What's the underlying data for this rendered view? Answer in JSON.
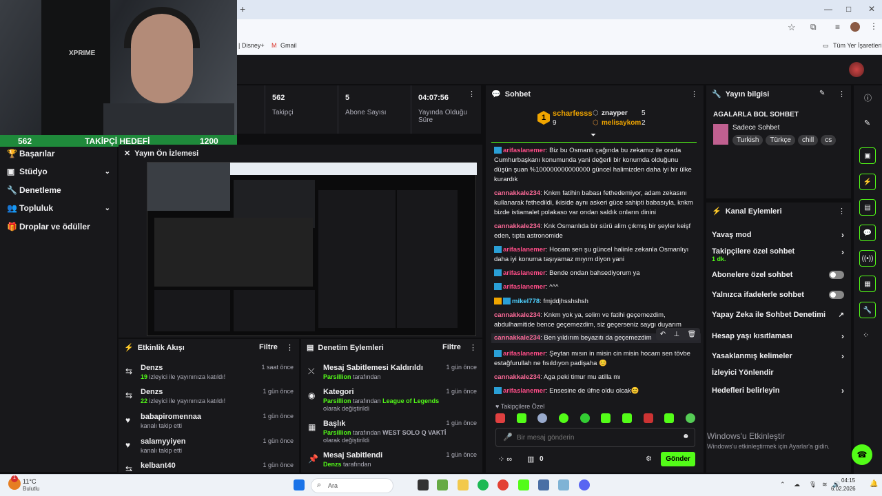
{
  "browser": {
    "new_tab": "+",
    "bookmarks": [
      "| Disney+",
      "Gmail"
    ],
    "bookmarks_folder": "Tüm Yer İşaretleri",
    "window_controls": [
      "—",
      "□",
      "✕"
    ]
  },
  "webcam": {
    "brand": "XPRIME"
  },
  "goal": {
    "current": "562",
    "label": "TAKİPÇİ HEDEFİ",
    "target": "1200"
  },
  "sidebar": {
    "items": [
      {
        "label": "Başarılar",
        "icon": "trophy-icon"
      },
      {
        "label": "Stüdyo",
        "icon": "video-icon",
        "chevron": "⌄"
      },
      {
        "label": "Denetleme",
        "icon": "wrench-icon"
      },
      {
        "label": "Topluluk",
        "icon": "people-icon",
        "chevron": "⌄"
      },
      {
        "label": "Droplar ve ödüller",
        "icon": "gift-icon"
      }
    ]
  },
  "stats": [
    {
      "value": "562",
      "label": "Takipçi"
    },
    {
      "value": "5",
      "label": "Abone Sayısı"
    },
    {
      "value": "04:07:56",
      "label": "Yayında Olduğu Süre"
    }
  ],
  "preview": {
    "title": "Yayın Ön İzlemesi"
  },
  "activity": {
    "title": "Etkinlik Akışı",
    "filter": "Filtre",
    "items": [
      {
        "name": "Denzs",
        "count": "19",
        "text": "izleyici ile yayınınıza katıldı!",
        "time": "1 saat önce"
      },
      {
        "name": "Denzs",
        "count": "22",
        "text": "izleyici ile yayınınıza katıldı!",
        "time": "1 gün önce"
      },
      {
        "name": "babapiromennaa",
        "text": "kanalı takip etti",
        "time": "1 gün önce"
      },
      {
        "name": "salamyyiyen",
        "text": "kanalı takip etti",
        "time": "1 gün önce"
      },
      {
        "name": "kelbant40",
        "time": "1 gün önce"
      }
    ]
  },
  "moderation": {
    "title": "Denetim Eylemleri",
    "filter": "Filtre",
    "items": [
      {
        "title": "Mesaj Sabitlemesi Kaldırıldı",
        "actor": "Parsillion",
        "text": "tarafından",
        "time": "1 gün önce"
      },
      {
        "title": "Kategori",
        "actor": "Parsillion",
        "text": "tarafından",
        "extra": "League of Legends",
        "text2": "olarak değiştirildi",
        "time": "1 gün önce"
      },
      {
        "title": "Başlık",
        "actor": "Parsillion",
        "text": "tarafından",
        "extra": "WEST SOLO Q VAKTİ",
        "text2": "olarak değiştirildi",
        "time": "1 gün önce"
      },
      {
        "title": "Mesaj Sabitlendi",
        "actor": "Denzs",
        "text": "tarafından",
        "time": "1 gün önce"
      }
    ]
  },
  "chat": {
    "title": "Sohbet",
    "leaders": [
      {
        "rank": "1",
        "name": "scharfesss",
        "count": "9"
      },
      {
        "name": "znayper",
        "count": "5"
      },
      {
        "name": "melisaykom",
        "count": "2"
      }
    ],
    "messages": [
      {
        "user": "arifaslanemer",
        "text": "Biz bu Osmanlı çağında bu zekamız ile orada Cumhurbaşkanı konumunda yani değerli bir konumda olduğunu düşün şuan %100000000000000 güncel halimizden daha iyi bir ülke kurardık"
      },
      {
        "user": "cannakkale234",
        "text": "Knkm fatihin babası fethedemiyor, adam zekasını kullanarak fethedildi, ikiside aynı askeri güce sahipti babasıyla, knkm bizde istiamalet polakaso var ondan saldık onların dinini"
      },
      {
        "user": "cannakkale234",
        "text": "Knk Osmanlıda bir sürü alim çıkmış bir şeyler keişf eden, tıpta astronomide"
      },
      {
        "user": "arifaslanemer",
        "text": "Hocam sen şu güncel halinle zekanla Osmanlıyı daha iyi konuma taşıyamaz mıyım diyon yani"
      },
      {
        "user": "arifaslanemer",
        "text": "Bende ondan bahsediyorum ya"
      },
      {
        "user": "arifaslanemer",
        "text": "^^^"
      },
      {
        "user": "mikel778",
        "text": "fmjddjhsshshsh"
      },
      {
        "user": "cannakkale234",
        "text": "Knkm yok ya, selim ve fatihi geçemezdim, abdulhamitide bence geçemezdim, siz geçerseniz saygı duyarım"
      },
      {
        "user": "cannakkale234",
        "text": "Ben yıldırım beyazıtı da geçemezdim"
      },
      {
        "user": "arifaslanemer",
        "text": "Şeytan mısın in misin cin misin hocam sen tövbe estağfurullah ne fısıldıyon padişaha 😊"
      },
      {
        "user": "cannakkale234",
        "text": "Aga peki timur mu atilla mı"
      },
      {
        "user": "arifaslanemer",
        "text": "Ensesine de üfne oldu olcak😊"
      }
    ],
    "followers_only": "Takipçilere Özel",
    "input_placeholder": "Bir mesaj gönderin",
    "points": "0",
    "send": "Gönder"
  },
  "stream_info": {
    "title": "Yayın bilgisi",
    "stream_title": "AGALARLA BOL SOHBET",
    "category": "Sadece Sohbet",
    "tags": [
      "Turkish",
      "Türkçe",
      "chill",
      "cs"
    ]
  },
  "channel_actions": {
    "title": "Kanal Eylemleri",
    "items": [
      {
        "label": "Yavaş mod",
        "type": "chevron"
      },
      {
        "label": "Takipçilere özel sohbet",
        "sub": "1 dk.",
        "type": "chevron"
      },
      {
        "label": "Abonelere özel sohbet",
        "type": "toggle"
      },
      {
        "label": "Yalnızca ifadelerle sohbet",
        "type": "toggle"
      },
      {
        "label": "Yapay Zeka ile Sohbet Denetimi",
        "type": "external"
      },
      {
        "label": "Hesap yaşı kısıtlaması",
        "type": "chevron"
      },
      {
        "label": "Yasaklanmış kelimeler",
        "type": "chevron"
      },
      {
        "label": "İzleyici Yönlendir",
        "type": "none"
      },
      {
        "label": "Hedefleri belirleyin",
        "type": "chevron"
      }
    ]
  },
  "windows_activation": {
    "title": "Windows'u Etkinleştir",
    "sub": "Windows'u etkinleştirmek için Ayarlar'a gidin."
  },
  "taskbar": {
    "weather_temp": "11°C",
    "weather_desc": "Bulutlu",
    "search": "Ara",
    "time": "04:15",
    "date": "6.02.2026",
    "notif": "1"
  },
  "colors": {
    "accent": "#53fc18",
    "panel": "#18181b",
    "bg": "#0e0e10"
  }
}
